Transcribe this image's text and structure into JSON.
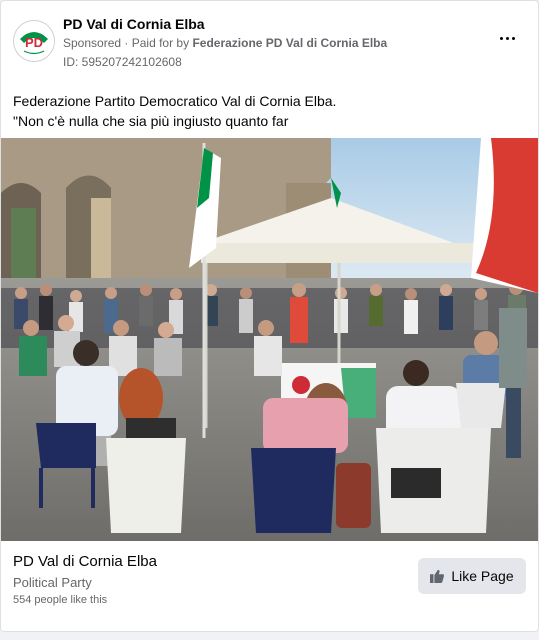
{
  "header": {
    "page_name": "PD Val di Cornia Elba",
    "sponsored": "Sponsored",
    "paid_prefix": "Paid for by",
    "funder": "Federazione PD Val di Cornia Elba",
    "ad_id": "ID: 595207242102608"
  },
  "post": {
    "line1": "Federazione Partito Democratico Val di Cornia Elba.",
    "line2": "\"Non c'è nulla che sia più ingiusto quanto far"
  },
  "footer": {
    "page_name": "PD Val di Cornia Elba",
    "category": "Political Party",
    "likes": "554 people like this",
    "like_button": "Like Page"
  },
  "logo_text": "PD",
  "colors": {
    "brand_green": "#009246",
    "brand_red": "#ce2b37",
    "text_secondary": "#65676b"
  }
}
